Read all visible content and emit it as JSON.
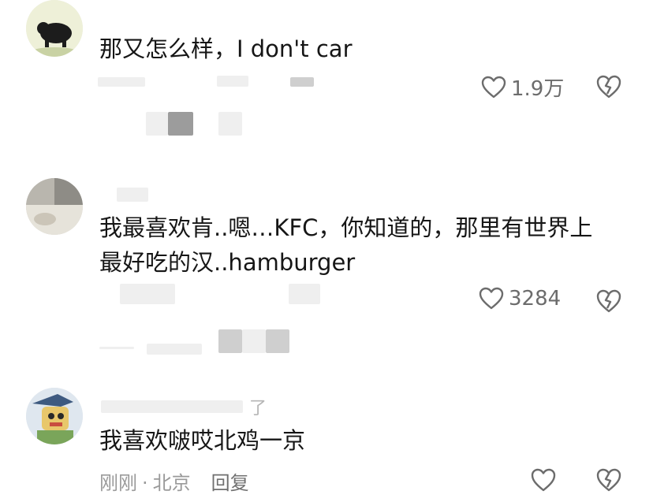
{
  "comments": [
    {
      "text": "那又怎么样，I don't car",
      "likes": "1.9万"
    },
    {
      "text_line1": "我最喜欢肯..嗯…KFC，你知道的，那里有世界上",
      "text_line2": "最好吃的汉..hamburger",
      "likes": "3284"
    },
    {
      "username_fragment": "了",
      "text": "我喜欢啵哎北鸡一京",
      "time": "刚刚",
      "location": "北京",
      "reply_label": "回复"
    }
  ],
  "icons": {
    "like": "heart-outline-icon",
    "dislike": "broken-heart-icon"
  },
  "colors": {
    "text": "#161616",
    "meta": "#9a9a9a",
    "icon": "#6c6c6c"
  }
}
